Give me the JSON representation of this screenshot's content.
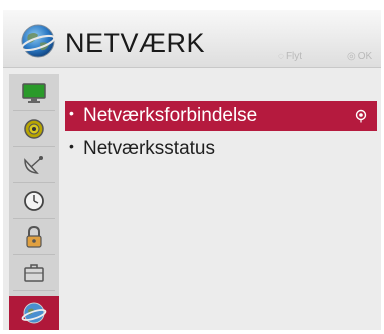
{
  "header": {
    "title": "NETVÆRK",
    "icon": "network-globe-icon",
    "hints": [
      {
        "icon": "navigation-arrows-icon",
        "label": "Flyt"
      },
      {
        "icon": "ok-button-icon",
        "label": "OK"
      }
    ]
  },
  "sidebar": {
    "items": [
      {
        "icon": "picture-monitor-icon"
      },
      {
        "icon": "audio-speaker-icon"
      },
      {
        "icon": "satellite-dish-icon"
      },
      {
        "icon": "clock-icon"
      },
      {
        "icon": "lock-icon"
      },
      {
        "icon": "options-briefcase-icon"
      },
      {
        "icon": "network-globe-icon",
        "active": true
      }
    ]
  },
  "menu": {
    "items": [
      {
        "label": "Netværksforbindelse",
        "selected": true
      },
      {
        "label": "Netværksstatus",
        "selected": false
      }
    ]
  },
  "colors": {
    "accent": "#b51a3e",
    "background": "#ececec",
    "sidebar": "#d2d2d2"
  }
}
